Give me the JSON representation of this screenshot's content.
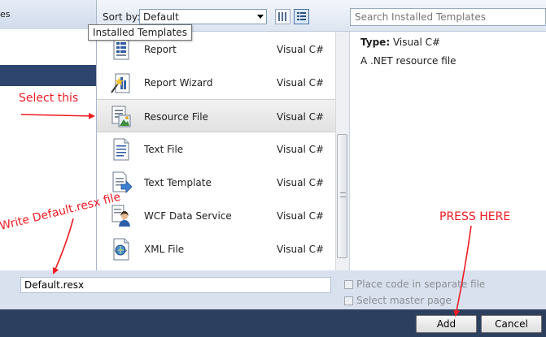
{
  "left_panel": {
    "header_label": "es"
  },
  "toolbar": {
    "sort_label": "Sort by:",
    "sort_value": "Default",
    "search_placeholder": "Search Installed Templates"
  },
  "tooltip": "Installed Templates",
  "templates": [
    {
      "name": "Report",
      "language": "Visual C#",
      "icon": "report-icon"
    },
    {
      "name": "Report Wizard",
      "language": "Visual C#",
      "icon": "report-wizard-icon"
    },
    {
      "name": "Resource File",
      "language": "Visual C#",
      "icon": "resource-file-icon",
      "selected": true
    },
    {
      "name": "Text File",
      "language": "Visual C#",
      "icon": "text-file-icon"
    },
    {
      "name": "Text Template",
      "language": "Visual C#",
      "icon": "text-template-icon"
    },
    {
      "name": "WCF Data Service",
      "language": "Visual C#",
      "icon": "wcf-data-service-icon"
    },
    {
      "name": "XML File",
      "language": "Visual C#",
      "icon": "xml-file-icon"
    }
  ],
  "details": {
    "type_label": "Type:",
    "type_value": "Visual C#",
    "description": "A .NET resource file"
  },
  "name_field": {
    "value": "Default.resx"
  },
  "options": {
    "separate_file": "Place code in separate file",
    "master_page": "Select master page"
  },
  "buttons": {
    "add": "Add",
    "cancel": "Cancel"
  },
  "annotations": {
    "select_this": "Select this",
    "write_name": "Write Default.resx file",
    "press_here": "PRESS HERE",
    "color": "#ee1c24"
  }
}
